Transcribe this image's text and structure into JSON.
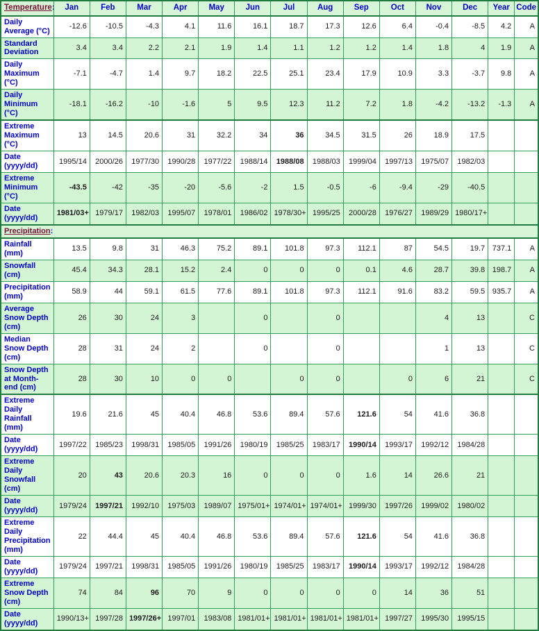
{
  "table": {
    "columns": [
      "Jan",
      "Feb",
      "Mar",
      "Apr",
      "May",
      "Jun",
      "Jul",
      "Aug",
      "Sep",
      "Oct",
      "Nov",
      "Dec",
      "Year",
      "Code"
    ],
    "sections": [
      {
        "title": "Temperature",
        "colon": ":"
      },
      {
        "title": "Precipitation",
        "colon": ":"
      }
    ],
    "rows": [
      {
        "label": "Daily Average (°C)",
        "shade": "plain",
        "values": [
          "-12.6",
          "-10.5",
          "-4.3",
          "4.1",
          "11.6",
          "16.1",
          "18.7",
          "17.3",
          "12.6",
          "6.4",
          "-0.4",
          "-8.5",
          "4.2",
          "A"
        ],
        "bold": []
      },
      {
        "label": "Standard Deviation",
        "shade": "shade",
        "values": [
          "3.4",
          "3.4",
          "2.2",
          "2.1",
          "1.9",
          "1.4",
          "1.1",
          "1.2",
          "1.2",
          "1.4",
          "1.8",
          "4",
          "1.9",
          "A"
        ],
        "bold": []
      },
      {
        "label": "Daily Maximum (°C)",
        "shade": "plain",
        "values": [
          "-7.1",
          "-4.7",
          "1.4",
          "9.7",
          "18.2",
          "22.5",
          "25.1",
          "23.4",
          "17.9",
          "10.9",
          "3.3",
          "-3.7",
          "9.8",
          "A"
        ],
        "bold": []
      },
      {
        "label": "Daily Minimum (°C)",
        "shade": "shade",
        "values": [
          "-18.1",
          "-16.2",
          "-10",
          "-1.6",
          "5",
          "9.5",
          "12.3",
          "11.2",
          "7.2",
          "1.8",
          "-4.2",
          "-13.2",
          "-1.3",
          "A"
        ],
        "bold": []
      },
      {
        "label": "Extreme Maximum (°C)",
        "shade": "plain",
        "blockTop": true,
        "values": [
          "13",
          "14.5",
          "20.6",
          "31",
          "32.2",
          "34",
          "36",
          "34.5",
          "31.5",
          "26",
          "18.9",
          "17.5",
          "",
          ""
        ],
        "bold": [
          6
        ]
      },
      {
        "label": "Date (yyyy/dd)",
        "shade": "plain",
        "values": [
          "1995/14",
          "2000/26",
          "1977/30",
          "1990/28",
          "1977/22",
          "1988/14",
          "1988/08",
          "1988/03",
          "1999/04",
          "1997/13",
          "1975/07",
          "1982/03",
          "",
          ""
        ],
        "bold": [
          6
        ]
      },
      {
        "label": "Extreme Minimum (°C)",
        "shade": "shade",
        "values": [
          "-43.5",
          "-42",
          "-35",
          "-20",
          "-5.6",
          "-2",
          "1.5",
          "-0.5",
          "-6",
          "-9.4",
          "-29",
          "-40.5",
          "",
          ""
        ],
        "bold": [
          0
        ]
      },
      {
        "label": "Date (yyyy/dd)",
        "shade": "shade",
        "values": [
          "1981/03+",
          "1979/17",
          "1982/03",
          "1995/07",
          "1978/01",
          "1986/02",
          "1978/30+",
          "1995/25",
          "2000/28",
          "1976/27",
          "1989/29",
          "1980/17+",
          "",
          ""
        ],
        "bold": [
          0
        ]
      },
      {
        "section": 1
      },
      {
        "label": "Rainfall (mm)",
        "shade": "plain",
        "values": [
          "13.5",
          "9.8",
          "31",
          "46.3",
          "75.2",
          "89.1",
          "101.8",
          "97.3",
          "112.1",
          "87",
          "54.5",
          "19.7",
          "737.1",
          "A"
        ],
        "bold": []
      },
      {
        "label": "Snowfall (cm)",
        "shade": "shade",
        "values": [
          "45.4",
          "34.3",
          "28.1",
          "15.2",
          "2.4",
          "0",
          "0",
          "0",
          "0.1",
          "4.6",
          "28.7",
          "39.8",
          "198.7",
          "A"
        ],
        "bold": []
      },
      {
        "label": "Precipitation (mm)",
        "shade": "plain",
        "values": [
          "58.9",
          "44",
          "59.1",
          "61.5",
          "77.6",
          "89.1",
          "101.8",
          "97.3",
          "112.1",
          "91.6",
          "83.2",
          "59.5",
          "935.7",
          "A"
        ],
        "bold": []
      },
      {
        "label": "Average Snow Depth (cm)",
        "shade": "shade",
        "values": [
          "26",
          "30",
          "24",
          "3",
          "",
          "0",
          "",
          "0",
          "",
          "",
          "4",
          "13",
          "",
          "C"
        ],
        "bold": []
      },
      {
        "label": "Median Snow Depth (cm)",
        "shade": "plain",
        "values": [
          "28",
          "31",
          "24",
          "2",
          "",
          "0",
          "",
          "0",
          "",
          "",
          "1",
          "13",
          "",
          "C"
        ],
        "bold": []
      },
      {
        "label": "Snow Depth at Month-end (cm)",
        "shade": "shade",
        "values": [
          "28",
          "30",
          "10",
          "0",
          "0",
          "",
          "0",
          "0",
          "",
          "0",
          "6",
          "21",
          "",
          "C"
        ],
        "bold": []
      },
      {
        "label": "Extreme Daily Rainfall (mm)",
        "shade": "plain",
        "blockTop": true,
        "values": [
          "19.6",
          "21.6",
          "45",
          "40.4",
          "46.8",
          "53.6",
          "89.4",
          "57.6",
          "121.6",
          "54",
          "41.6",
          "36.8",
          "",
          ""
        ],
        "bold": [
          8
        ]
      },
      {
        "label": "Date (yyyy/dd)",
        "shade": "plain",
        "values": [
          "1997/22",
          "1985/23",
          "1998/31",
          "1985/05",
          "1991/26",
          "1980/19",
          "1985/25",
          "1983/17",
          "1990/14",
          "1993/17",
          "1992/12",
          "1984/28",
          "",
          ""
        ],
        "bold": [
          8
        ]
      },
      {
        "label": "Extreme Daily Snowfall (cm)",
        "shade": "shade",
        "values": [
          "20",
          "43",
          "20.6",
          "20.3",
          "16",
          "0",
          "0",
          "0",
          "1.6",
          "14",
          "26.6",
          "21",
          "",
          ""
        ],
        "bold": [
          1
        ]
      },
      {
        "label": "Date (yyyy/dd)",
        "shade": "shade",
        "values": [
          "1979/24",
          "1997/21",
          "1992/10",
          "1975/03",
          "1989/07",
          "1975/01+",
          "1974/01+",
          "1974/01+",
          "1999/30",
          "1997/26",
          "1999/02",
          "1980/02",
          "",
          ""
        ],
        "bold": [
          1
        ]
      },
      {
        "label": "Extreme Daily Precipitation (mm)",
        "shade": "plain",
        "values": [
          "22",
          "44.4",
          "45",
          "40.4",
          "46.8",
          "53.6",
          "89.4",
          "57.6",
          "121.6",
          "54",
          "41.6",
          "36.8",
          "",
          ""
        ],
        "bold": [
          8
        ]
      },
      {
        "label": "Date (yyyy/dd)",
        "shade": "plain",
        "values": [
          "1979/24",
          "1997/21",
          "1998/31",
          "1985/05",
          "1991/26",
          "1980/19",
          "1985/25",
          "1983/17",
          "1990/14",
          "1993/17",
          "1992/12",
          "1984/28",
          "",
          ""
        ],
        "bold": [
          8
        ]
      },
      {
        "label": "Extreme Snow Depth (cm)",
        "shade": "shade",
        "values": [
          "74",
          "84",
          "96",
          "70",
          "9",
          "0",
          "0",
          "0",
          "0",
          "14",
          "36",
          "51",
          "",
          ""
        ],
        "bold": [
          2
        ]
      },
      {
        "label": "Date (yyyy/dd)",
        "shade": "shade",
        "values": [
          "1990/13+",
          "1997/28",
          "1997/26+",
          "1997/01",
          "1983/08",
          "1981/01+",
          "1981/01+",
          "1981/01+",
          "1981/01+",
          "1997/27",
          "1995/30",
          "1995/15",
          "",
          ""
        ],
        "bold": [
          2
        ]
      }
    ]
  },
  "colors": {
    "header_bg": "#d7f5d7",
    "shade_bg": "#d4f5d4",
    "border": "#2e9e5b",
    "border_strong": "#1f7a3d",
    "label_text": "#0000cc",
    "section_title": "#7a1038",
    "value_text": "#1a1a1a"
  }
}
